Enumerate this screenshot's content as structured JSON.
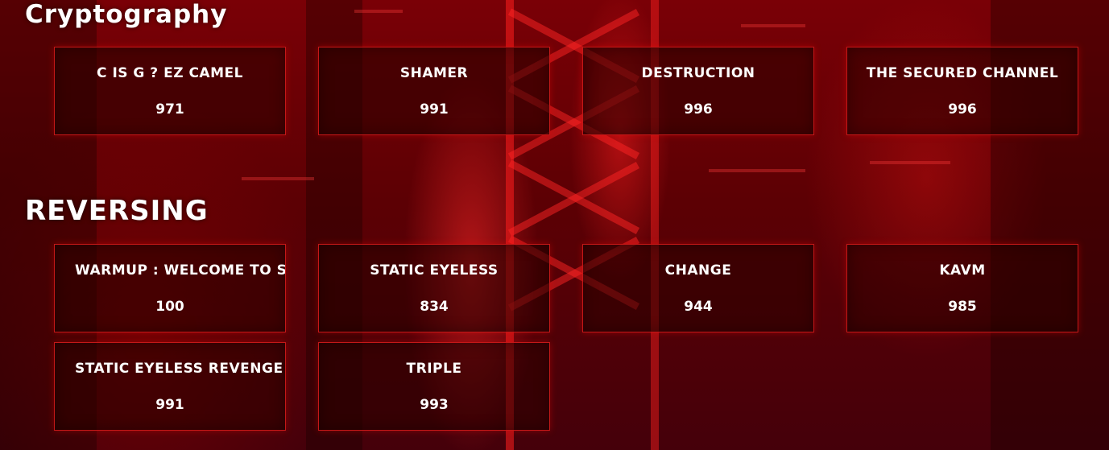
{
  "sections": [
    {
      "title": "Cryptography",
      "challenges": [
        {
          "name": "C IS G ? EZ CAMEL",
          "points": "971"
        },
        {
          "name": "SHAMER",
          "points": "991"
        },
        {
          "name": "DESTRUCTION",
          "points": "996"
        },
        {
          "name": "THE SECURED CHANNEL",
          "points": "996"
        }
      ]
    },
    {
      "title": "REVERSING",
      "challenges": [
        {
          "name": "WARMUP : WELCOME TO S",
          "points": "100"
        },
        {
          "name": "STATIC EYELESS",
          "points": "834"
        },
        {
          "name": "CHANGE",
          "points": "944"
        },
        {
          "name": "KAVM",
          "points": "985"
        },
        {
          "name": "STATIC EYELESS REVENGE",
          "points": "991"
        },
        {
          "name": "TRIPLE",
          "points": "993"
        }
      ]
    }
  ],
  "colors": {
    "background": "#5c0004",
    "card_border": "#c41818",
    "text": "#ffffff"
  }
}
